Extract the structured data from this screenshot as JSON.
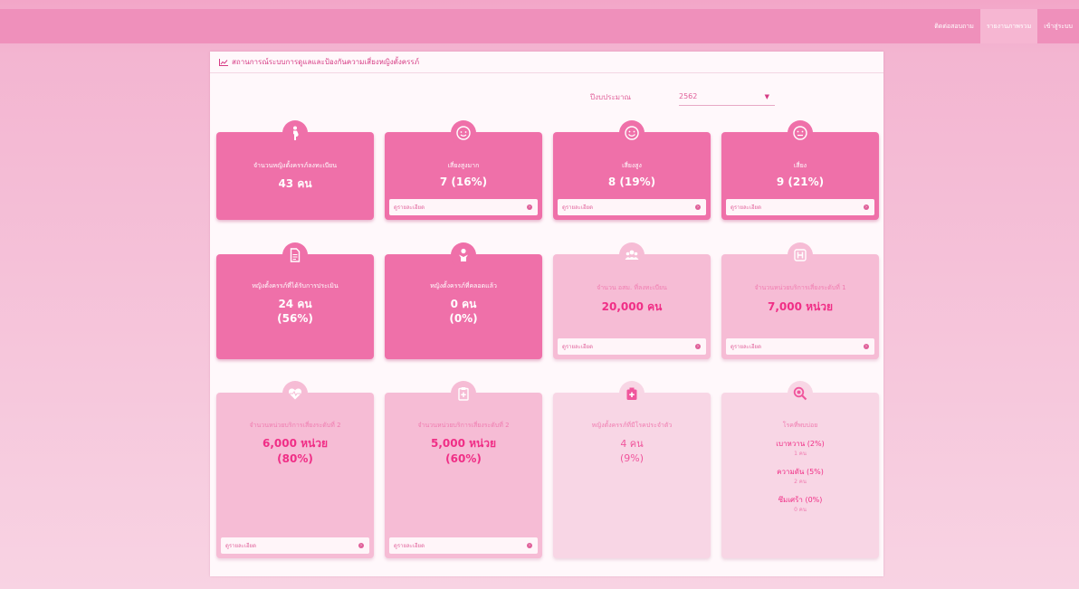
{
  "nav": {
    "items": [
      {
        "label": "ติดต่อสอบถาม",
        "active": false
      },
      {
        "label": "รายงานภาพรวม",
        "active": true
      },
      {
        "label": "เข้าสู่ระบบ",
        "active": false
      }
    ]
  },
  "panel": {
    "title": "สถานการณ์ระบบการดูแลและป้องกันความเสี่ยงหญิงตั้งครรภ์"
  },
  "filter": {
    "label": "ปีงบประมาณ",
    "selected": "2562"
  },
  "cards": {
    "registered": {
      "title": "จำนวนหญิงตั้งครรภ์ลงทะเบียน",
      "value": "43 คน"
    },
    "very_high_risk": {
      "title": "เสี่ยงสูงมาก",
      "value": "7 (16%)",
      "footer": "ดูรายละเอียด"
    },
    "high_risk": {
      "title": "เสี่ยงสูง",
      "value": "8 (19%)",
      "footer": "ดูรายละเอียด"
    },
    "risk": {
      "title": "เสี่ยง",
      "value": "9 (21%)",
      "footer": "ดูรายละเอียด"
    },
    "assessed": {
      "title": "หญิงตั้งครรภ์ที่ได้รับการประเมิน",
      "value": "24 คน",
      "percent": "(56%)"
    },
    "delivered": {
      "title": "หญิงตั้งครรภ์ที่คลอดแล้ว",
      "value": "0 คน",
      "percent": "(0%)"
    },
    "volunteers": {
      "title": "จำนวน อสม. ที่ลงทะเบียน",
      "value": "20,000 คน",
      "footer": "ดูรายละเอียด"
    },
    "service_level1": {
      "title": "จำนวนหน่วยบริการเสี่ยงระดับที่ 1",
      "value": "7,000 หน่วย",
      "footer": "ดูรายละเอียด"
    },
    "service_level2a": {
      "title": "จำนวนหน่วยบริการเสี่ยงระดับที่ 2",
      "value": "6,000 หน่วย",
      "percent": "(80%)",
      "footer": "ดูรายละเอียด"
    },
    "service_level2b": {
      "title": "จำนวนหน่วยบริการเสี่ยงระดับที่ 2",
      "value": "5,000 หน่วย",
      "percent": "(60%)",
      "footer": "ดูรายละเอียด"
    },
    "chronic": {
      "title": "หญิงตั้งครรภ์ที่มีโรคประจำตัว",
      "value": "4 คน",
      "percent": "(9%)"
    },
    "diseases": {
      "title": "โรคที่พบบ่อย",
      "items": [
        {
          "name": "เบาหวาน (2%)",
          "count": "1 คน"
        },
        {
          "name": "ความดัน (5%)",
          "count": "2 คน"
        },
        {
          "name": "ซึมเศร้า (0%)",
          "count": "0 คน"
        }
      ]
    }
  },
  "colors": {
    "solid": "#ef70a9",
    "soft": "#f6bcd5",
    "pale": "#f8d6e5",
    "accent": "#d63b84"
  }
}
